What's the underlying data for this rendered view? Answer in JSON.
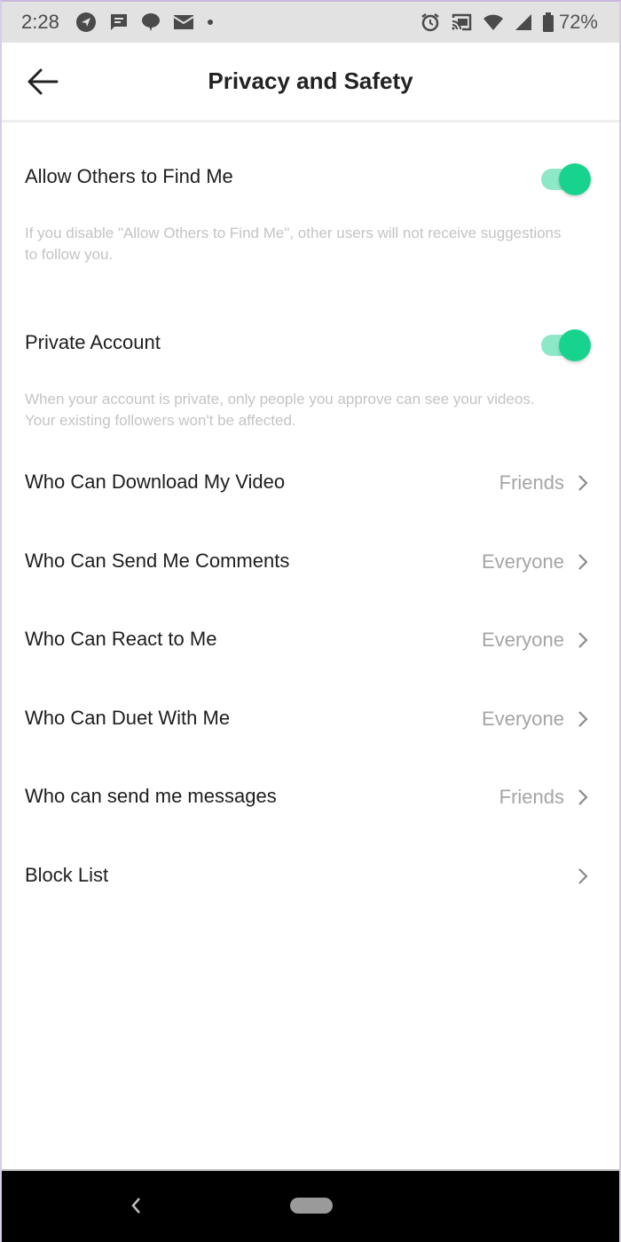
{
  "status_bar": {
    "time": "2:28",
    "left_icons": [
      "navigation-icon",
      "message-icon",
      "chat-bubble-icon",
      "mail-icon",
      "dot-icon"
    ],
    "right_icons": [
      "alarm-icon",
      "cast-icon",
      "wifi-icon",
      "signal-icon",
      "battery-icon"
    ],
    "battery_percent": "72%"
  },
  "header": {
    "title": "Privacy and Safety",
    "back_icon": "arrow-left-icon"
  },
  "toggles": [
    {
      "label": "Allow Others to Find Me",
      "enabled": true,
      "description": "If you disable \"Allow Others to Find Me\", other users will not receive suggestions to follow you."
    },
    {
      "label": "Private Account",
      "enabled": true,
      "description": "When your account is private, only people you approve can see your videos. Your existing followers won't be affected."
    }
  ],
  "settings": [
    {
      "label": "Who Can Download My Video",
      "value": "Friends"
    },
    {
      "label": "Who Can Send Me Comments",
      "value": "Everyone"
    },
    {
      "label": "Who Can React to Me",
      "value": "Everyone"
    },
    {
      "label": "Who Can Duet With Me",
      "value": "Everyone"
    },
    {
      "label": "Who can send me messages",
      "value": "Friends"
    },
    {
      "label": "Block List",
      "value": ""
    }
  ],
  "colors": {
    "toggle_on_knob": "#18d38e",
    "toggle_on_track": "#8ee8c8",
    "value_text": "#a5a5a5",
    "description_text": "#c4c4c4"
  },
  "system_nav": {
    "back_icon": "nav-back-icon",
    "home_icon": "home-pill-icon"
  }
}
